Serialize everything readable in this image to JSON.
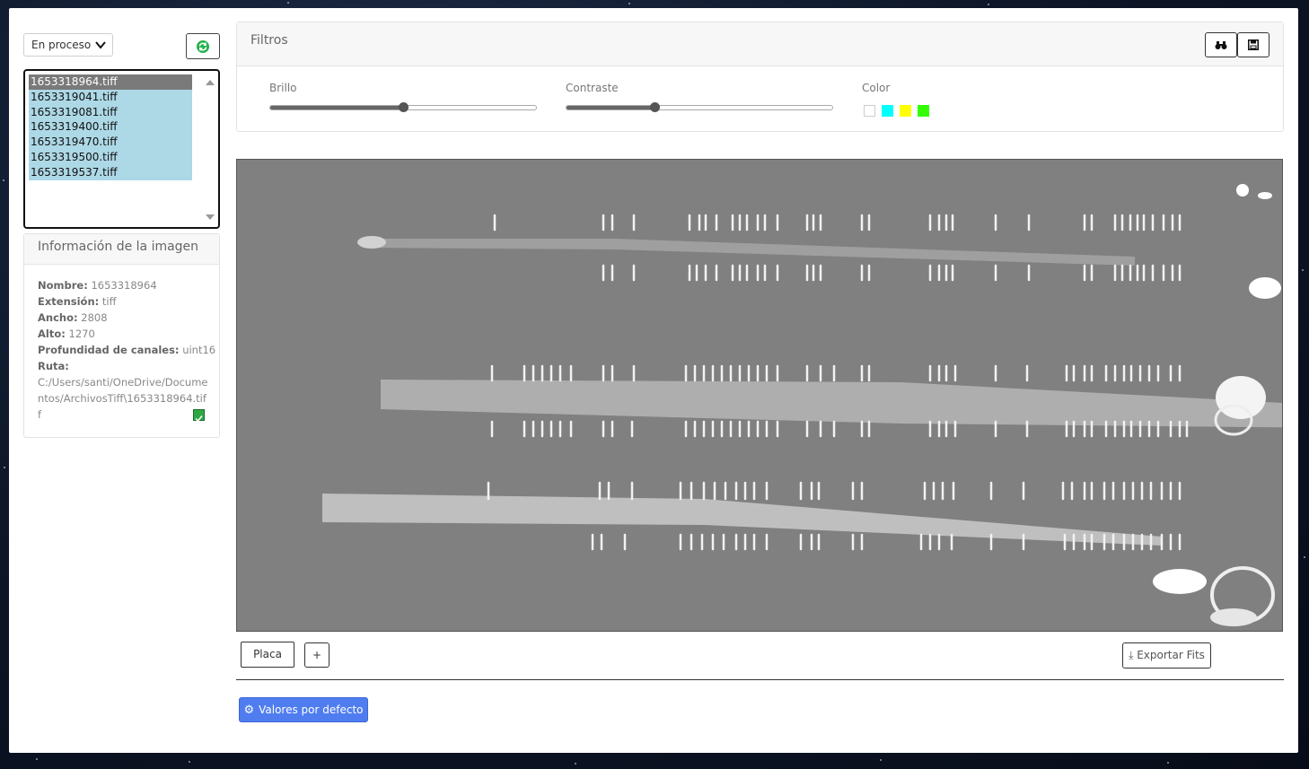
{
  "status_select": {
    "value": "En proceso"
  },
  "files": [
    "1653318964.tiff",
    "1653319041.tiff",
    "1653319081.tiff",
    "1653319400.tiff",
    "1653319470.tiff",
    "1653319500.tiff",
    "1653319537.tiff"
  ],
  "selected_file_index": 0,
  "info": {
    "title": "Información de la imagen",
    "nombre_label": "Nombre:",
    "nombre": "1653318964",
    "extension_label": "Extensión:",
    "extension": "tiff",
    "ancho_label": "Ancho:",
    "ancho": "2808",
    "alto_label": "Alto:",
    "alto": "1270",
    "profundidad_label": "Profundidad de canales:",
    "profundidad": "uint16",
    "ruta_label": "Ruta:",
    "ruta": "C:/Users/santi/OneDrive/Documentos/ArchivosTiff\\1653318964.tiff"
  },
  "filters": {
    "title": "Filtros",
    "brillo_label": "Brillo",
    "brillo_value": 0.5,
    "contraste_label": "Contraste",
    "contraste_value": 0.33,
    "color_label": "Color",
    "colors": [
      "#ffffff",
      "#00ffff",
      "#ffff00",
      "#33ff00"
    ]
  },
  "icons": {
    "refresh": "refresh-icon",
    "binoculars": "binoculars-icon",
    "save": "save-icon",
    "gear": "gear-icon"
  },
  "actions": {
    "placa_label": "Placa",
    "add_label": "+",
    "export_label": "⤓ Exportar Fits",
    "defaults_label": "Valores por defecto"
  }
}
